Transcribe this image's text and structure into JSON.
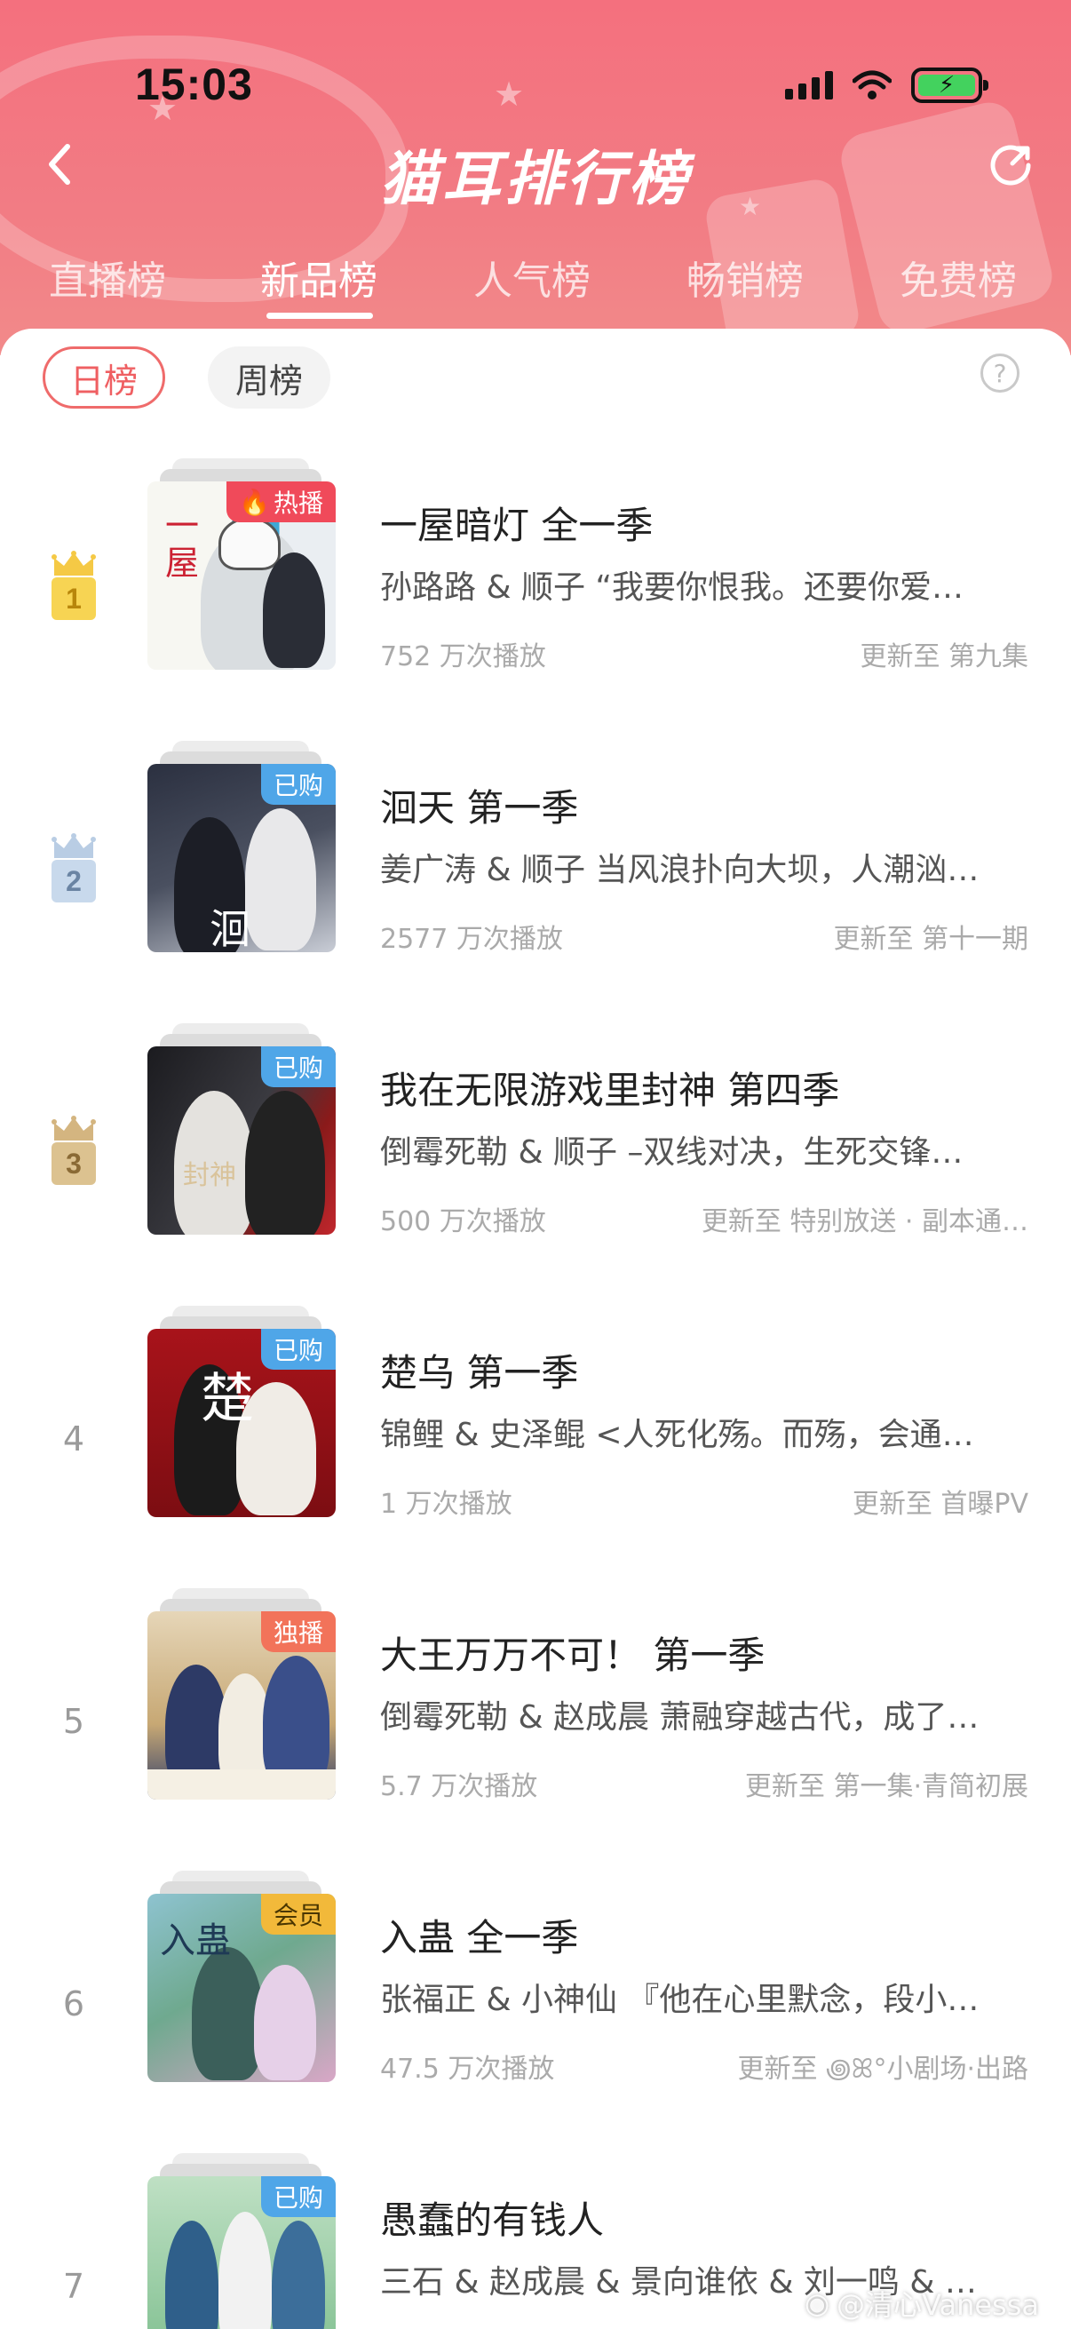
{
  "status_bar": {
    "time": "15:03"
  },
  "header": {
    "title": "猫耳排行榜",
    "tabs": [
      {
        "label": "直播榜",
        "active": false
      },
      {
        "label": "新品榜",
        "active": true
      },
      {
        "label": "人气榜",
        "active": false
      },
      {
        "label": "畅销榜",
        "active": false
      },
      {
        "label": "免费榜",
        "active": false
      }
    ]
  },
  "filters": {
    "day": "日榜",
    "week": "周榜",
    "selected": "日榜",
    "help": "?"
  },
  "colors": {
    "accent": "#ef5f62",
    "gold": "#f5c945",
    "silver": "#b9cde4",
    "bronze": "#d4b580"
  },
  "items": [
    {
      "rank": "1",
      "title": "一屋暗灯 全一季",
      "desc": "孙路路 & 顺子 “我要你恨我。还要你爱…",
      "plays": "752 万次播放",
      "update": "更新至 第九集",
      "tag": "热播",
      "tag_color": "#f04a5a"
    },
    {
      "rank": "2",
      "title": "洄天 第一季",
      "desc": "姜广涛 & 顺子 当风浪扑向大坝，人潮汹…",
      "plays": "2577 万次播放",
      "update": "更新至 第十一期",
      "tag": "已购",
      "tag_color": "#4fa6e8"
    },
    {
      "rank": "3",
      "title": "我在无限游戏里封神 第四季",
      "desc": "倒霉死勒 & 顺子 –双线对决，生死交锋…",
      "plays": "500 万次播放",
      "update": "更新至 特别放送 · 副本通…",
      "tag": "已购",
      "tag_color": "#4fa6e8"
    },
    {
      "rank": "4",
      "title": "楚乌 第一季",
      "desc": "锦鲤 & 史泽鲲 <人死化殇。而殇，会通…",
      "plays": "1 万次播放",
      "update": "更新至 首曝PV",
      "tag": "已购",
      "tag_color": "#4fa6e8"
    },
    {
      "rank": "5",
      "title": "大王万万不可！ 第一季",
      "desc": "倒霉死勒 & 赵成晨 萧融穿越古代，成了…",
      "plays": "5.7 万次播放",
      "update": "更新至 第一集·青简初展",
      "tag": "独播",
      "tag_color": "#f2735a"
    },
    {
      "rank": "6",
      "title": "入蛊 全一季",
      "desc": "张福正 & 小神仙 『他在心里默念，段小…",
      "plays": "47.5 万次播放",
      "update": "更新至 ꩜ꕤ°小剧场·出路",
      "tag": "会员",
      "tag_color": "#f2b93a"
    },
    {
      "rank": "7",
      "title": "愚蠢的有钱人",
      "desc": "三石 & 赵成晨 & 景向谁依 & 刘一鸣 & …",
      "plays": "",
      "update": "",
      "tag": "已购",
      "tag_color": "#4fa6e8"
    }
  ],
  "watermark": "@清心Vanessa"
}
